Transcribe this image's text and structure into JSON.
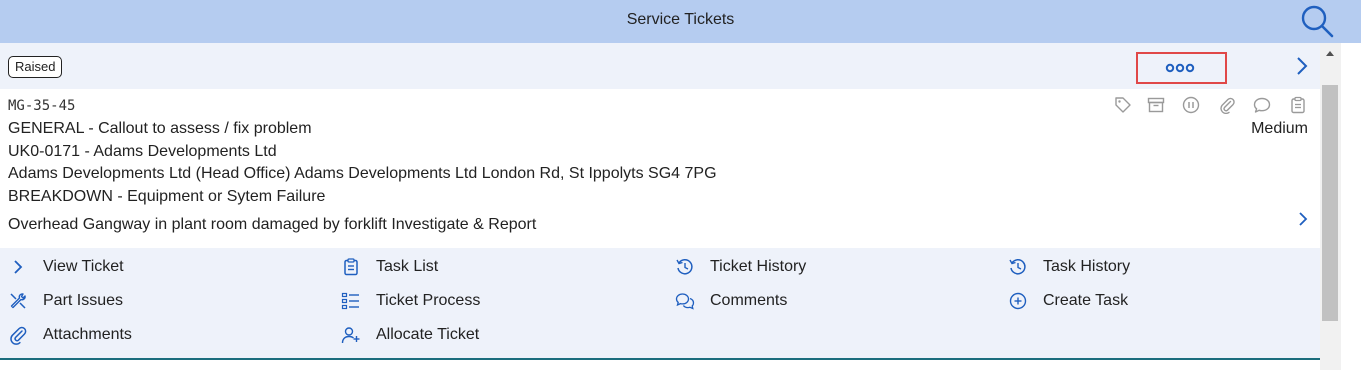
{
  "header": {
    "title": "Service Tickets",
    "search_icon": "search-icon"
  },
  "ticket": {
    "status": "Raised",
    "more_icon": "more-dots-icon",
    "ref": "MG-35-45",
    "category": "GENERAL - Callout to assess / fix problem",
    "customer": "UK0-0171 - Adams Developments Ltd",
    "site": "Adams Developments Ltd (Head Office) Adams Developments Ltd London Rd, St Ippolyts SG4 7PG",
    "fault": "BREAKDOWN - Equipment or Sytem Failure",
    "description": "Overhead Gangway in plant room damaged by forklift Investigate & Report",
    "priority": "Medium",
    "icons": [
      "tag-icon",
      "archive-icon",
      "pause-icon",
      "paperclip-icon",
      "comment-icon",
      "clipboard-icon"
    ]
  },
  "actions": {
    "view_ticket": "View Ticket",
    "task_list": "Task List",
    "ticket_history": "Ticket History",
    "task_history": "Task History",
    "part_issues": "Part Issues",
    "ticket_process": "Ticket Process",
    "comments": "Comments",
    "create_task": "Create Task",
    "attachments": "Attachments",
    "allocate_ticket": "Allocate Ticket"
  },
  "colors": {
    "header_bg": "#b5ccf0",
    "accent": "#1f5fbf",
    "highlight": "#e04848",
    "row_bg": "#eef2fa"
  }
}
